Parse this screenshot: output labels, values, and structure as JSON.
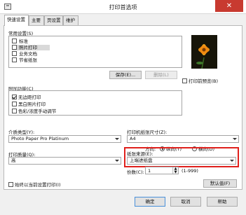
{
  "window": {
    "title": "打印首选项",
    "close_glyph": "✕"
  },
  "tabs": [
    "快速设置",
    "主要",
    "页设置",
    "维护"
  ],
  "common_settings": {
    "label": "常用设置(S)",
    "items": [
      {
        "label": "标准",
        "selected": false
      },
      {
        "label": "照片打印",
        "selected": true
      },
      {
        "label": "业务文档",
        "selected": false
      },
      {
        "label": "节省纸张",
        "selected": false
      }
    ],
    "save_button": "保存(E)...",
    "delete_button": "删除(L)"
  },
  "preview": {
    "checkbox_label": "打印前预览(B)",
    "checked": false
  },
  "additional_features": {
    "label": "附加功能(C)",
    "items": [
      {
        "label": "无边距打印",
        "checked": true
      },
      {
        "label": "黑白照片打印",
        "checked": false
      },
      {
        "label": "色彩/浓度手动调节",
        "checked": false
      }
    ]
  },
  "media_type": {
    "label": "介质类型(Y):",
    "value": "Photo Paper Pro Platinum"
  },
  "paper_size": {
    "label": "打印机纸张尺寸(Z):",
    "value": "A4"
  },
  "orientation": {
    "label": "方向:",
    "portrait": "纵向(T)",
    "landscape": "横向(D)",
    "selected": "portrait"
  },
  "print_quality": {
    "label": "打印质量(Q):",
    "value": "高"
  },
  "paper_source": {
    "label": "纸张来源(E):",
    "value": "上端进纸盘"
  },
  "copies": {
    "label": "份数(C):",
    "value": "1",
    "range": "(1-999)"
  },
  "always_print_current": {
    "label": "始终以当前设置打印(I)",
    "checked": false
  },
  "defaults_button": "默认值(F)",
  "footer": {
    "ok": "确定",
    "cancel": "取消",
    "help": "帮助"
  },
  "highlight_color": "#e0201c"
}
